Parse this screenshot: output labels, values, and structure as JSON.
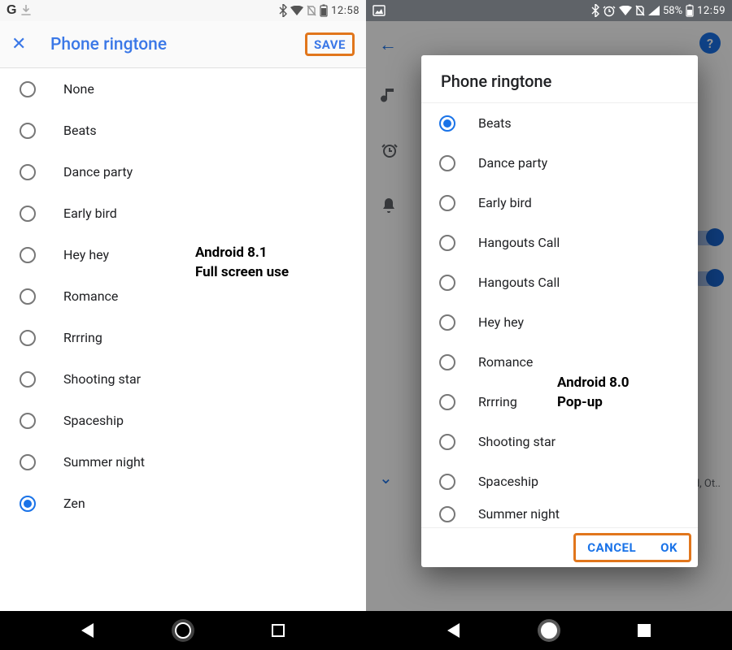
{
  "left": {
    "statusbar": {
      "clock": "12:58"
    },
    "appbar": {
      "title": "Phone ringtone",
      "save": "SAVE"
    },
    "selected_index": 10,
    "items": [
      "None",
      "Beats",
      "Dance party",
      "Early bird",
      "Hey hey",
      "Romance",
      "Rrrring",
      "Shooting star",
      "Spaceship",
      "Summer night",
      "Zen"
    ],
    "caption_line1": "Android 8.1",
    "caption_line2": "Full screen use"
  },
  "right": {
    "statusbar": {
      "battery_pct": "58%",
      "clock": "12:59"
    },
    "background": {
      "truncated_text": "nd, Ot.."
    },
    "dialog": {
      "title": "Phone ringtone",
      "selected_index": 0,
      "items": [
        "Beats",
        "Dance party",
        "Early bird",
        "Hangouts Call",
        "Hangouts Call",
        "Hey hey",
        "Romance",
        "Rrrring",
        "Shooting star",
        "Spaceship",
        "Summer night"
      ],
      "cancel": "CANCEL",
      "ok": "OK"
    },
    "caption_line1": "Android 8.0",
    "caption_line2": "Pop-up"
  }
}
